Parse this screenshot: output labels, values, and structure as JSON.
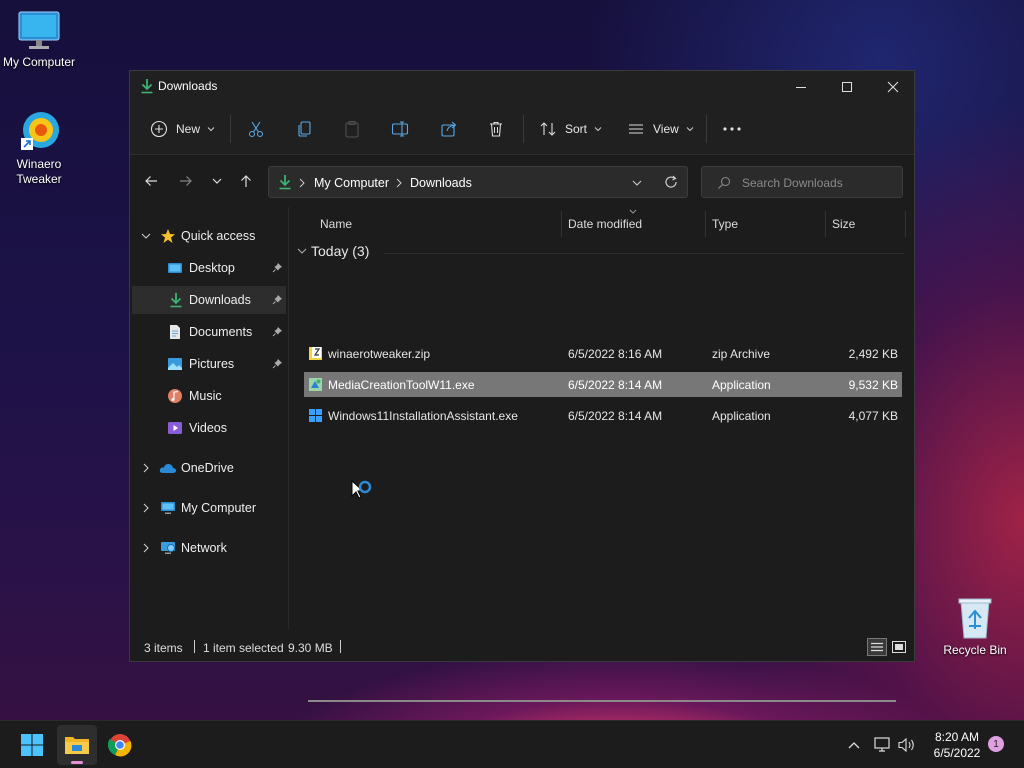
{
  "desktop": {
    "icons": [
      {
        "label": "My Computer"
      },
      {
        "label": "Winaero Tweaker"
      },
      {
        "label": "Recycle Bin"
      }
    ]
  },
  "window": {
    "title": "Downloads",
    "controls": {
      "minimize": "minimize-icon",
      "maximize": "maximize-icon",
      "close": "close-icon"
    }
  },
  "toolbar": {
    "new_label": "New",
    "sort_label": "Sort",
    "view_label": "View"
  },
  "address": {
    "crumbs": [
      "My Computer",
      "Downloads"
    ]
  },
  "search": {
    "placeholder": "Search Downloads"
  },
  "sidebar": {
    "quick_access": "Quick access",
    "items": [
      {
        "label": "Desktop",
        "icon": "desktop-folder-icon",
        "pinned": true
      },
      {
        "label": "Downloads",
        "icon": "download-icon",
        "pinned": true
      },
      {
        "label": "Documents",
        "icon": "documents-icon",
        "pinned": true
      },
      {
        "label": "Pictures",
        "icon": "pictures-icon",
        "pinned": true
      },
      {
        "label": "Music",
        "icon": "music-icon",
        "pinned": false
      },
      {
        "label": "Videos",
        "icon": "videos-icon",
        "pinned": false
      }
    ],
    "onedrive": "OneDrive",
    "my_computer": "My Computer",
    "network": "Network"
  },
  "columns": {
    "name": "Name",
    "date": "Date modified",
    "type": "Type",
    "size": "Size"
  },
  "group": {
    "label": "Today (3)"
  },
  "files": [
    {
      "name": "winaerotweaker.zip",
      "date": "6/5/2022 8:16 AM",
      "type": "zip Archive",
      "size": "2,492 KB",
      "selected": false
    },
    {
      "name": "MediaCreationToolW11.exe",
      "date": "6/5/2022 8:14 AM",
      "type": "Application",
      "size": "9,532 KB",
      "selected": true
    },
    {
      "name": "Windows11InstallationAssistant.exe",
      "date": "6/5/2022 8:14 AM",
      "type": "Application",
      "size": "4,077 KB",
      "selected": false
    }
  ],
  "status": {
    "items": "3 items",
    "selected": "1 item selected",
    "size": "9.30 MB"
  },
  "taskbar": {
    "time": "8:20 AM",
    "date": "6/5/2022",
    "notification_count": "1"
  },
  "colors": {
    "accent": "#0078d4",
    "selected_row": "#777777",
    "download_green": "#3cb371"
  }
}
